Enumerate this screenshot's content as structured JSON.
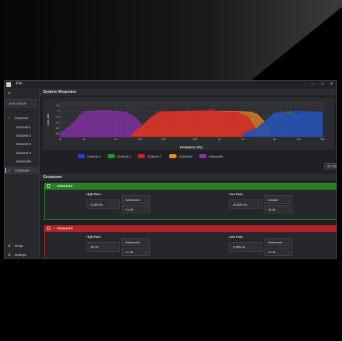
{
  "titlebar": {
    "menu_file": "File",
    "minimize": "—",
    "maximize": "□",
    "close": "✕"
  },
  "sidebar": {
    "device_mode": "Demo Mode",
    "items": [
      {
        "label": "Channels",
        "icon": "home-icon"
      },
      {
        "label": "Channel 1"
      },
      {
        "label": "Channel 2"
      },
      {
        "label": "Channel 3"
      },
      {
        "label": "Channel 4"
      },
      {
        "label": "Subwoofer"
      },
      {
        "label": "Crossover",
        "icon": "crossover-icon",
        "active": true
      }
    ],
    "bottom": [
      {
        "label": "Setup",
        "icon": "setup-icon"
      },
      {
        "label": "Settings",
        "icon": "gear-icon"
      }
    ]
  },
  "system_response": {
    "title": "System Response",
    "collapse": "⌃"
  },
  "crossover": {
    "title": "Crossover"
  },
  "chart_data": {
    "type": "area",
    "xlabel": "Frequency (Hz)",
    "ylabel": "Gain (dB)",
    "x_scale": "log",
    "xlim": [
      10,
      20000
    ],
    "x_ticks": [
      "10",
      "20",
      "50",
      "100",
      "200",
      "500",
      "1k",
      "2k",
      "5k",
      "10k",
      "20k"
    ],
    "x_tick_values": [
      10,
      20,
      50,
      100,
      200,
      500,
      1000,
      2000,
      5000,
      10000,
      20000
    ],
    "y_ticks": [
      "-40",
      "-30",
      "-20",
      "-10",
      "0",
      "10"
    ],
    "y_tick_values": [
      -40,
      -30,
      -20,
      -10,
      0,
      10
    ],
    "ylim": [
      -45,
      15
    ],
    "grid": true,
    "series": [
      {
        "name": "Channel 1",
        "color": "#2a3fd6",
        "points": [
          [
            2000,
            -40
          ],
          [
            3000,
            -30
          ],
          [
            4000,
            -15
          ],
          [
            5000,
            -3
          ],
          [
            6000,
            -2
          ],
          [
            8000,
            -5
          ],
          [
            9000,
            2
          ],
          [
            10000,
            0
          ],
          [
            15000,
            -2
          ],
          [
            20000,
            -1
          ]
        ]
      },
      {
        "name": "Channel 2",
        "color": "#1f9a2a",
        "points": [
          [
            2000,
            -40
          ],
          [
            3000,
            -30
          ],
          [
            4000,
            -15
          ],
          [
            5000,
            -4
          ],
          [
            6000,
            -3
          ],
          [
            8000,
            -1
          ],
          [
            9000,
            -3
          ],
          [
            10000,
            -6
          ],
          [
            12000,
            -1
          ],
          [
            15000,
            -3
          ],
          [
            20000,
            -2
          ]
        ]
      },
      {
        "name": "Channel 3",
        "color": "#d01f2a",
        "points": [
          [
            80,
            -40
          ],
          [
            110,
            -25
          ],
          [
            140,
            -10
          ],
          [
            180,
            0
          ],
          [
            250,
            -1
          ],
          [
            400,
            0
          ],
          [
            700,
            1
          ],
          [
            800,
            4
          ],
          [
            900,
            0
          ],
          [
            1200,
            -1
          ],
          [
            1700,
            -2
          ],
          [
            2300,
            -10
          ],
          [
            2700,
            -25
          ],
          [
            3200,
            -40
          ]
        ]
      },
      {
        "name": "Channel 4",
        "color": "#f08a1c",
        "points": [
          [
            80,
            -40
          ],
          [
            110,
            -25
          ],
          [
            140,
            -12
          ],
          [
            180,
            -3
          ],
          [
            250,
            -1
          ],
          [
            400,
            0
          ],
          [
            700,
            -1
          ],
          [
            1000,
            0
          ],
          [
            1500,
            0
          ],
          [
            2000,
            -1
          ],
          [
            2500,
            -2
          ],
          [
            3000,
            -5
          ],
          [
            3800,
            -20
          ],
          [
            4500,
            -40
          ]
        ]
      },
      {
        "name": "Subwoofer",
        "color": "#8f2fb0",
        "points": [
          [
            10,
            -40
          ],
          [
            15,
            -20
          ],
          [
            18,
            -6
          ],
          [
            22,
            0
          ],
          [
            35,
            1
          ],
          [
            50,
            0
          ],
          [
            70,
            -3
          ],
          [
            90,
            -12
          ],
          [
            110,
            -28
          ],
          [
            130,
            -40
          ]
        ]
      }
    ]
  },
  "legend_items": [
    "Channel 1",
    "Channel 2",
    "Channel 3",
    "Channel 4",
    "Subwoofer"
  ],
  "all_channels_label": "All Channels",
  "cards": [
    {
      "name": "Channel 2",
      "color": "#2a7f25",
      "body_border": "#2a7f25",
      "high_pass": {
        "label": "High Pass",
        "freq": "3,200 Hz.",
        "type": "Butterworth",
        "slope": "24 dB."
      },
      "low_pass": {
        "label": "Low Pass",
        "freq": "20,000 Hz.",
        "type": "Linkwitz",
        "slope": "24 dB."
      }
    },
    {
      "name": "Channel 3",
      "color": "#b3232b",
      "body_border": "#b3232b",
      "high_pass": {
        "label": "High Pass",
        "freq": "80 Hz.",
        "type": "Butterworth",
        "slope": "24 dB."
      },
      "low_pass": {
        "label": "Low Pass",
        "freq": "3,200 Hz.",
        "type": "Butterworth",
        "slope": "24 dB."
      }
    }
  ]
}
